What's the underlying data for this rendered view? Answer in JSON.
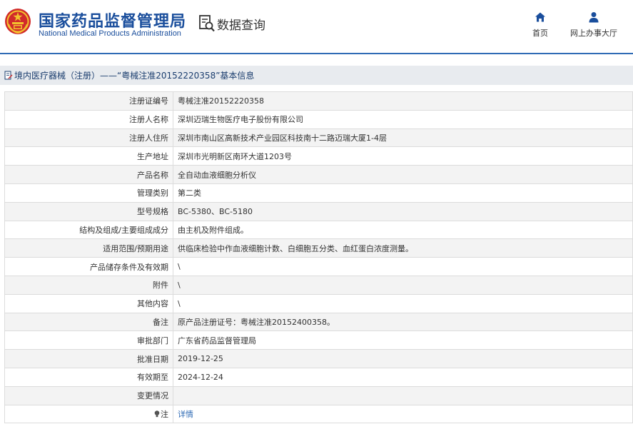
{
  "header": {
    "logo_cn": "国家药品监督管理局",
    "logo_en": "National Medical Products Administration",
    "query_label": "数据查询",
    "nav": [
      {
        "label": "首页",
        "icon": "home-icon"
      },
      {
        "label": "网上办事大厅",
        "icon": "user-icon"
      }
    ]
  },
  "colors": {
    "brand": "#1a4e9c",
    "accent_line": "#2f6bb5",
    "link": "#2f6bb5",
    "emblem_red": "#d12a2a",
    "emblem_gold": "#f2c12e"
  },
  "breadcrumb": {
    "text": "境内医疗器械（注册）——“粤械注准20152220358”基本信息"
  },
  "rows": [
    {
      "label": "注册证编号",
      "value": "粤械注准20152220358"
    },
    {
      "label": "注册人名称",
      "value": "深圳迈瑞生物医疗电子股份有限公司"
    },
    {
      "label": "注册人住所",
      "value": "深圳市南山区高新技术产业园区科技南十二路迈瑞大厦1-4层"
    },
    {
      "label": "生产地址",
      "value": "深圳市光明新区南环大道1203号"
    },
    {
      "label": "产品名称",
      "value": "全自动血液细胞分析仪"
    },
    {
      "label": "管理类别",
      "value": "第二类"
    },
    {
      "label": "型号规格",
      "value": "BC-5380、BC-5180"
    },
    {
      "label": "结构及组成/主要组成成分",
      "value": "由主机及附件组成。"
    },
    {
      "label": "适用范围/预期用途",
      "value": "供临床检验中作血液细胞计数、白细胞五分类、血红蛋白浓度测量。"
    },
    {
      "label": "产品储存条件及有效期",
      "value": "\\"
    },
    {
      "label": "附件",
      "value": "\\"
    },
    {
      "label": "其他内容",
      "value": "\\"
    },
    {
      "label": "备注",
      "value": "原产品注册证号：粤械注准20152400358。"
    },
    {
      "label": "审批部门",
      "value": "广东省药品监督管理局"
    },
    {
      "label": "批准日期",
      "value": "2019-12-25"
    },
    {
      "label": "有效期至",
      "value": "2024-12-24"
    },
    {
      "label": "变更情况",
      "value": ""
    }
  ],
  "note_row": {
    "label": "注",
    "icon": "lightbulb-icon",
    "link_text": "详情"
  }
}
